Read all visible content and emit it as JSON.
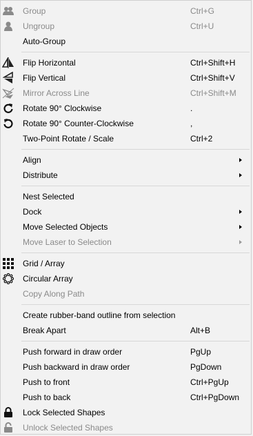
{
  "menu": {
    "sections": [
      [
        {
          "label": "Group",
          "shortcut": "Ctrl+G",
          "icon": "group-icon",
          "disabled": true
        },
        {
          "label": "Ungroup",
          "shortcut": "Ctrl+U",
          "icon": "ungroup-icon",
          "disabled": true
        },
        {
          "label": "Auto-Group",
          "shortcut": "",
          "icon": "",
          "disabled": false
        }
      ],
      [
        {
          "label": "Flip Horizontal",
          "shortcut": "Ctrl+Shift+H",
          "icon": "flip-horizontal-icon",
          "disabled": false
        },
        {
          "label": "Flip Vertical",
          "shortcut": "Ctrl+Shift+V",
          "icon": "flip-vertical-icon",
          "disabled": false
        },
        {
          "label": "Mirror Across Line",
          "shortcut": "Ctrl+Shift+M",
          "icon": "mirror-line-icon",
          "disabled": true
        },
        {
          "label": "Rotate 90° Clockwise",
          "shortcut": ".",
          "icon": "rotate-cw-icon",
          "disabled": false
        },
        {
          "label": "Rotate 90° Counter-Clockwise",
          "shortcut": ",",
          "icon": "rotate-ccw-icon",
          "disabled": false
        },
        {
          "label": "Two-Point Rotate / Scale",
          "shortcut": "Ctrl+2",
          "icon": "",
          "disabled": false
        }
      ],
      [
        {
          "label": "Align",
          "shortcut": "",
          "icon": "",
          "disabled": false,
          "submenu": true
        },
        {
          "label": "Distribute",
          "shortcut": "",
          "icon": "",
          "disabled": false,
          "submenu": true
        }
      ],
      [
        {
          "label": "Nest Selected",
          "shortcut": "",
          "icon": "",
          "disabled": false
        },
        {
          "label": "Dock",
          "shortcut": "",
          "icon": "",
          "disabled": false,
          "submenu": true
        },
        {
          "label": "Move Selected Objects",
          "shortcut": "",
          "icon": "",
          "disabled": false,
          "submenu": true
        },
        {
          "label": "Move Laser to Selection",
          "shortcut": "",
          "icon": "",
          "disabled": true,
          "submenu": true
        }
      ],
      [
        {
          "label": "Grid / Array",
          "shortcut": "",
          "icon": "grid-array-icon",
          "disabled": false
        },
        {
          "label": "Circular Array",
          "shortcut": "",
          "icon": "circular-array-icon",
          "disabled": false
        },
        {
          "label": "Copy Along Path",
          "shortcut": "",
          "icon": "",
          "disabled": true
        }
      ],
      [
        {
          "label": "Create rubber-band outline from selection",
          "shortcut": "",
          "icon": "",
          "disabled": false
        },
        {
          "label": "Break Apart",
          "shortcut": "Alt+B",
          "icon": "",
          "disabled": false
        }
      ],
      [
        {
          "label": "Push forward in draw order",
          "shortcut": "PgUp",
          "icon": "",
          "disabled": false
        },
        {
          "label": "Push backward in draw order",
          "shortcut": "PgDown",
          "icon": "",
          "disabled": false
        },
        {
          "label": "Push to front",
          "shortcut": "Ctrl+PgUp",
          "icon": "",
          "disabled": false
        },
        {
          "label": "Push to back",
          "shortcut": "Ctrl+PgDown",
          "icon": "",
          "disabled": false
        },
        {
          "label": "Lock Selected Shapes",
          "shortcut": "",
          "icon": "lock-icon",
          "disabled": false
        },
        {
          "label": "Unlock Selected Shapes",
          "shortcut": "",
          "icon": "unlock-icon",
          "disabled": true
        }
      ]
    ],
    "colors": {
      "background": "#f2f2f2",
      "disabled_text": "#8a8a8a",
      "separator": "#d7d7d7"
    }
  }
}
